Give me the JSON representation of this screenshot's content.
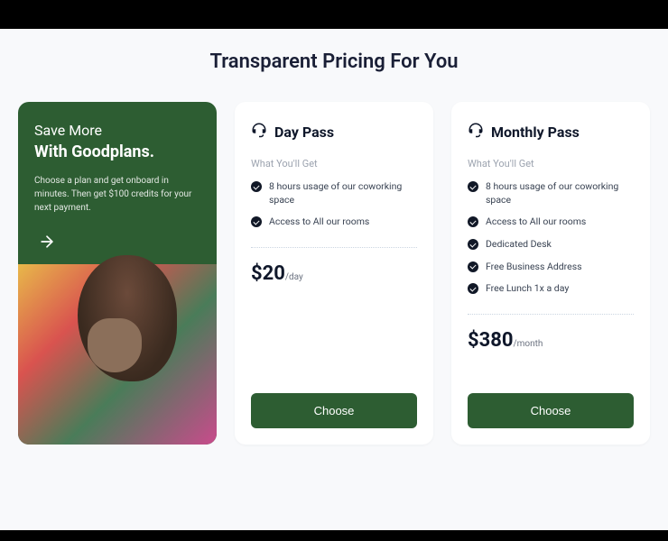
{
  "title": "Transparent Pricing For You",
  "promo": {
    "line1": "Save More",
    "line2": "With Goodplans.",
    "desc": "Choose a plan and get onboard in minutes. Then get $100 credits for your next payment."
  },
  "subhead": "What You'll Get",
  "plans": [
    {
      "name": "Day Pass",
      "features": [
        "8 hours usage of our coworking space",
        "Access to All our rooms"
      ],
      "price": "$20",
      "per": "/day",
      "cta": "Choose"
    },
    {
      "name": "Monthly Pass",
      "features": [
        "8 hours usage of our coworking space",
        "Access to All our rooms",
        "Dedicated Desk",
        "Free Business Address",
        "Free Lunch 1x a day"
      ],
      "price": "$380",
      "per": "/month",
      "cta": "Choose"
    }
  ]
}
